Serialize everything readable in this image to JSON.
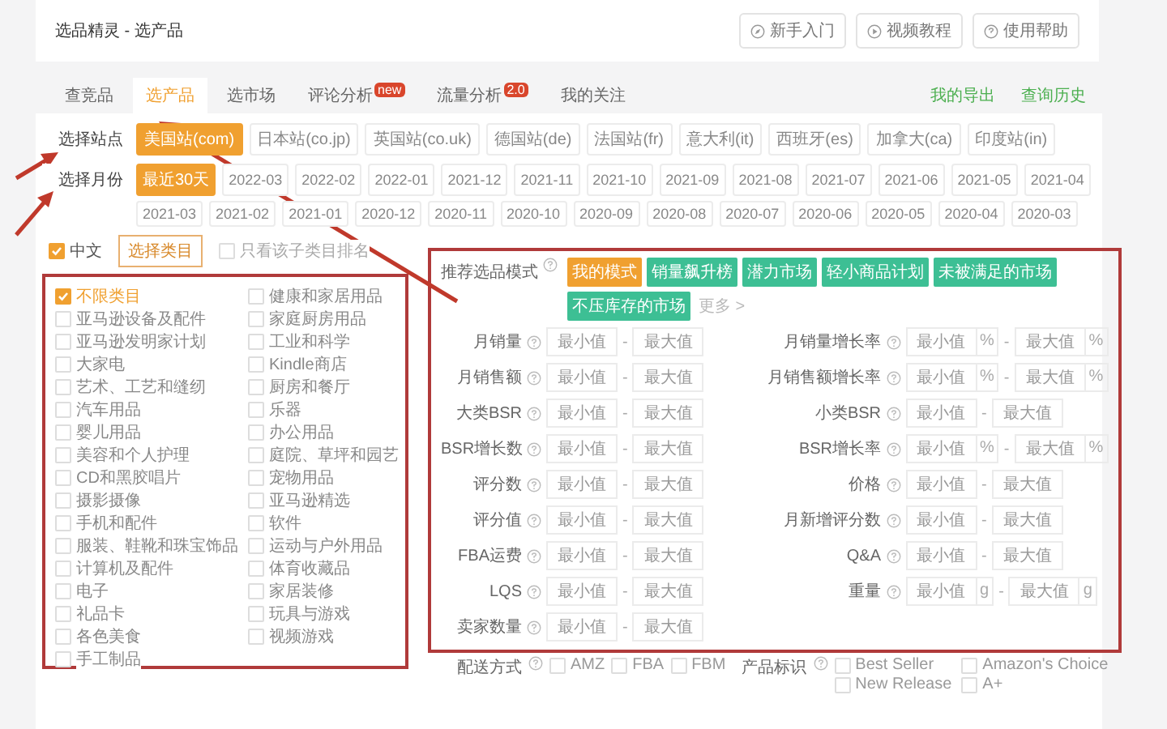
{
  "header": {
    "title": "选品精灵 - 选产品",
    "buttons": [
      {
        "label": "新手入门",
        "kind": "guide"
      },
      {
        "label": "视频教程",
        "kind": "video"
      },
      {
        "label": "使用帮助",
        "kind": "help"
      }
    ]
  },
  "tabs": [
    {
      "label": "查竞品",
      "selected": false
    },
    {
      "label": "选产品",
      "selected": true
    },
    {
      "label": "选市场",
      "selected": false
    },
    {
      "label": "评论分析",
      "selected": false,
      "badge": "new"
    },
    {
      "label": "流量分析",
      "selected": false,
      "badge": "2.0"
    },
    {
      "label": "我的关注",
      "selected": false
    }
  ],
  "tab_links": [
    "我的导出",
    "查询历史"
  ],
  "sites": {
    "label": "选择站点",
    "options": [
      {
        "label": "美国站(com)",
        "selected": true
      },
      {
        "label": "日本站(co.jp)",
        "selected": false
      },
      {
        "label": "英国站(co.uk)",
        "selected": false
      },
      {
        "label": "德国站(de)",
        "selected": false
      },
      {
        "label": "法国站(fr)",
        "selected": false
      },
      {
        "label": "意大利(it)",
        "selected": false
      },
      {
        "label": "西班牙(es)",
        "selected": false
      },
      {
        "label": "加拿大(ca)",
        "selected": false
      },
      {
        "label": "印度站(in)",
        "selected": false
      }
    ]
  },
  "months": {
    "label": "选择月份",
    "options": [
      {
        "label": "最近30天",
        "selected": true
      },
      {
        "label": "2022-03",
        "selected": false
      },
      {
        "label": "2022-02",
        "selected": false
      },
      {
        "label": "2022-01",
        "selected": false
      },
      {
        "label": "2021-12",
        "selected": false
      },
      {
        "label": "2021-11",
        "selected": false
      },
      {
        "label": "2021-10",
        "selected": false
      },
      {
        "label": "2021-09",
        "selected": false
      },
      {
        "label": "2021-08",
        "selected": false
      },
      {
        "label": "2021-07",
        "selected": false
      },
      {
        "label": "2021-06",
        "selected": false
      },
      {
        "label": "2021-05",
        "selected": false
      },
      {
        "label": "2021-04",
        "selected": false
      },
      {
        "label": "2021-03",
        "selected": false
      },
      {
        "label": "2021-02",
        "selected": false
      },
      {
        "label": "2021-01",
        "selected": false
      },
      {
        "label": "2020-12",
        "selected": false
      },
      {
        "label": "2020-11",
        "selected": false
      },
      {
        "label": "2020-10",
        "selected": false
      },
      {
        "label": "2020-09",
        "selected": false
      },
      {
        "label": "2020-08",
        "selected": false
      },
      {
        "label": "2020-07",
        "selected": false
      },
      {
        "label": "2020-06",
        "selected": false
      },
      {
        "label": "2020-05",
        "selected": false
      },
      {
        "label": "2020-04",
        "selected": false
      },
      {
        "label": "2020-03",
        "selected": false
      }
    ]
  },
  "category_options": {
    "language": {
      "label": "中文",
      "checked": true
    },
    "choose_button": "选择类目",
    "subcategory_rank": {
      "label": "只看该子类目排名",
      "checked": false
    }
  },
  "categories": [
    {
      "label": "不限类目",
      "checked": true
    },
    {
      "label": "亚马逊设备及配件",
      "checked": false
    },
    {
      "label": "亚马逊发明家计划",
      "checked": false
    },
    {
      "label": "大家电",
      "checked": false
    },
    {
      "label": "艺术、工艺和缝纫",
      "checked": false
    },
    {
      "label": "汽车用品",
      "checked": false
    },
    {
      "label": "婴儿用品",
      "checked": false
    },
    {
      "label": "美容和个人护理",
      "checked": false
    },
    {
      "label": "CD和黑胶唱片",
      "checked": false
    },
    {
      "label": "摄影摄像",
      "checked": false
    },
    {
      "label": "手机和配件",
      "checked": false
    },
    {
      "label": "服装、鞋靴和珠宝饰品",
      "checked": false
    },
    {
      "label": "计算机及配件",
      "checked": false
    },
    {
      "label": "电子",
      "checked": false
    },
    {
      "label": "礼品卡",
      "checked": false
    },
    {
      "label": "各色美食",
      "checked": false
    },
    {
      "label": "手工制品",
      "checked": false
    },
    {
      "label": "健康和家居用品",
      "checked": false
    },
    {
      "label": "家庭厨房用品",
      "checked": false
    },
    {
      "label": "工业和科学",
      "checked": false
    },
    {
      "label": "Kindle商店",
      "checked": false
    },
    {
      "label": "厨房和餐厅",
      "checked": false
    },
    {
      "label": "乐器",
      "checked": false
    },
    {
      "label": "办公用品",
      "checked": false
    },
    {
      "label": "庭院、草坪和园艺",
      "checked": false
    },
    {
      "label": "宠物用品",
      "checked": false
    },
    {
      "label": "亚马逊精选",
      "checked": false
    },
    {
      "label": "软件",
      "checked": false
    },
    {
      "label": "运动与户外用品",
      "checked": false
    },
    {
      "label": "体育收藏品",
      "checked": false
    },
    {
      "label": "家居装修",
      "checked": false
    },
    {
      "label": "玩具与游戏",
      "checked": false
    },
    {
      "label": "视频游戏",
      "checked": false
    }
  ],
  "mode": {
    "label": "推荐选品模式",
    "tags": [
      {
        "label": "我的模式",
        "color": "#f0a030"
      },
      {
        "label": "销量飙升榜",
        "color": "#3dbf94"
      },
      {
        "label": "潜力市场",
        "color": "#3dbf94"
      },
      {
        "label": "轻小商品计划",
        "color": "#3dbf94"
      },
      {
        "label": "未被满足的市场",
        "color": "#3dbf94"
      },
      {
        "label": "不压库存的市场",
        "color": "#3dbf94"
      }
    ],
    "more": "更多 >"
  },
  "filters": [
    {
      "label": "月销量",
      "min": {
        "placeholder": "最小值"
      },
      "max": {
        "placeholder": "最大值"
      },
      "separator": "-"
    },
    {
      "label": "月销量增长率",
      "min": {
        "placeholder": "最小值",
        "unit": "%"
      },
      "max": {
        "placeholder": "最大值",
        "unit": "%"
      },
      "separator": "-"
    },
    {
      "label": "月销售额",
      "min": {
        "placeholder": "最小值"
      },
      "max": {
        "placeholder": "最大值"
      },
      "separator": "-"
    },
    {
      "label": "月销售额增长率",
      "min": {
        "placeholder": "最小值",
        "unit": "%"
      },
      "max": {
        "placeholder": "最大值",
        "unit": "%"
      },
      "separator": "-"
    },
    {
      "label": "大类BSR",
      "min": {
        "placeholder": "最小值"
      },
      "max": {
        "placeholder": "最大值"
      },
      "separator": "-"
    },
    {
      "label": "小类BSR",
      "min": {
        "placeholder": "最小值"
      },
      "max": {
        "placeholder": "最大值"
      },
      "separator": "-"
    },
    {
      "label": "BSR增长数",
      "min": {
        "placeholder": "最小值"
      },
      "max": {
        "placeholder": "最大值"
      },
      "separator": "-"
    },
    {
      "label": "BSR增长率",
      "min": {
        "placeholder": "最小值",
        "unit": "%"
      },
      "max": {
        "placeholder": "最大值",
        "unit": "%"
      },
      "separator": "-"
    },
    {
      "label": "评分数",
      "min": {
        "placeholder": "最小值"
      },
      "max": {
        "placeholder": "最大值"
      },
      "separator": "-"
    },
    {
      "label": "价格",
      "min": {
        "placeholder": "最小值"
      },
      "max": {
        "placeholder": "最大值"
      },
      "separator": "-"
    },
    {
      "label": "评分值",
      "min": {
        "placeholder": "最小值"
      },
      "max": {
        "placeholder": "最大值"
      },
      "separator": "-"
    },
    {
      "label": "月新增评分数",
      "min": {
        "placeholder": "最小值"
      },
      "max": {
        "placeholder": "最大值"
      },
      "separator": "-"
    },
    {
      "label": "FBA运费",
      "min": {
        "placeholder": "最小值"
      },
      "max": {
        "placeholder": "最大值"
      },
      "separator": "-"
    },
    {
      "label": "Q&A",
      "min": {
        "placeholder": "最小值"
      },
      "max": {
        "placeholder": "最大值"
      },
      "separator": "-"
    },
    {
      "label": "LQS",
      "min": {
        "placeholder": "最小值"
      },
      "max": {
        "placeholder": "最大值"
      },
      "separator": "-"
    },
    {
      "label": "重量",
      "min": {
        "placeholder": "最小值",
        "unit": "g"
      },
      "max": {
        "placeholder": "最大值",
        "unit": "g"
      },
      "separator": "-"
    },
    {
      "label": "卖家数量",
      "min": {
        "placeholder": "最小值"
      },
      "max": {
        "placeholder": "最大值"
      },
      "separator": "-"
    }
  ],
  "delivery": {
    "label": "配送方式",
    "options": [
      {
        "label": "AMZ",
        "checked": false
      },
      {
        "label": "FBA",
        "checked": false
      },
      {
        "label": "FBM",
        "checked": false
      }
    ]
  },
  "badges": {
    "label": "产品标识",
    "options": [
      {
        "label": "Best Seller",
        "checked": false
      },
      {
        "label": "Amazon's Choice",
        "checked": false
      },
      {
        "label": "New Release",
        "checked": false
      },
      {
        "label": "A+",
        "checked": false
      }
    ]
  }
}
